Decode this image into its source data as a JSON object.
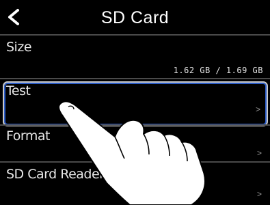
{
  "header": {
    "title": "SD Card"
  },
  "rows": [
    {
      "label": "Size",
      "value": "1.62 GB / 1.69 GB"
    },
    {
      "label": "Test",
      "chevron": ">"
    },
    {
      "label": "Format",
      "chevron": ">"
    },
    {
      "label": "SD Card Reader",
      "chevron": ">"
    }
  ],
  "icons": {
    "back": "chevron-left-icon",
    "hand": "pointing-hand-icon"
  },
  "colors": {
    "background": "#000000",
    "highlight_border": "#2b5cc7"
  }
}
